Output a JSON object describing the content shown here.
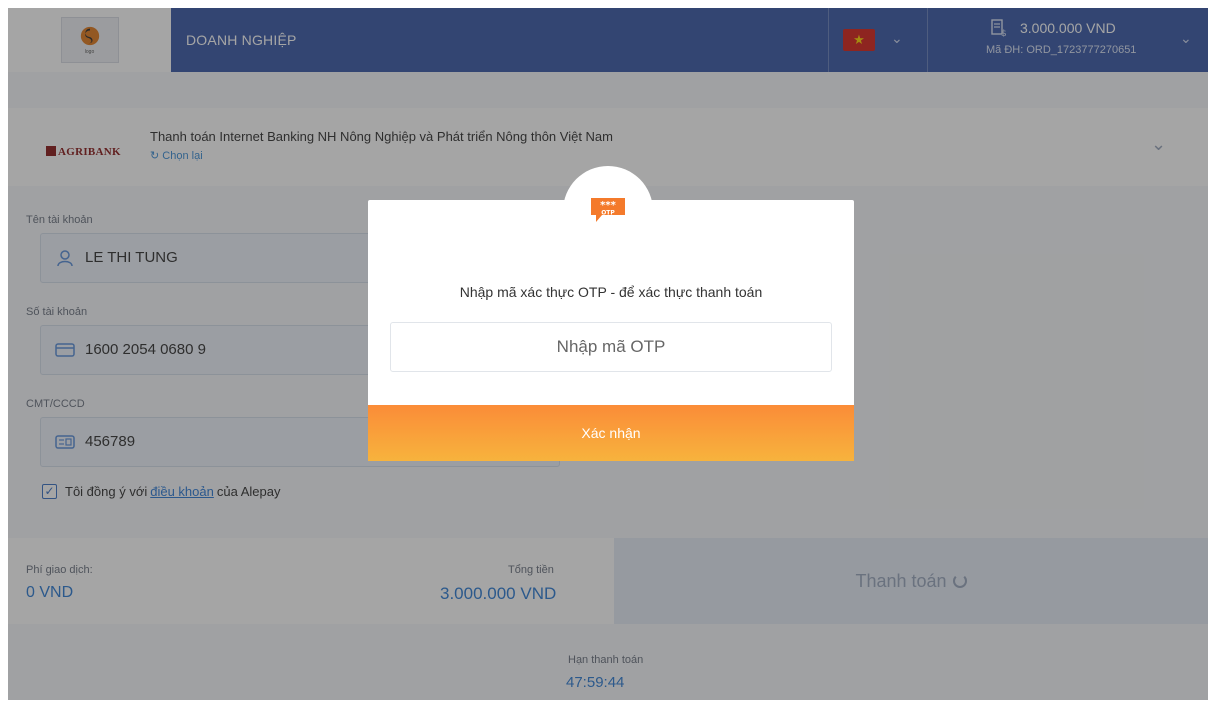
{
  "header": {
    "company_name": "DOANH NGHIỆP",
    "logo_text": "logo",
    "language_flag": "vietnam-flag",
    "amount": "3.000.000 VND",
    "order_id": "Mã ĐH: ORD_1723777270651"
  },
  "bank": {
    "logo_text": "AGRIBANK",
    "name": "Thanh toán Internet Banking NH Nông Nghiệp và Phát triển Nông thôn Việt Nam",
    "reselect": "Chọn lại"
  },
  "form": {
    "account_name_label": "Tên tài khoản",
    "account_name": "LE THI TUNG",
    "account_number_label": "Số tài khoản",
    "account_number": "1600 2054 0680 9",
    "id_label": "CMT/CCCD",
    "id_value": "456789",
    "agree_prefix": "Tôi đồng ý với",
    "agree_link": "điều khoản",
    "agree_suffix": "của Alepay",
    "agreed": true
  },
  "summary": {
    "fee_label": "Phí giao dịch:",
    "fee_value": "0 VND",
    "total_label": "Tổng tiền",
    "total_value": "3.000.000 VND",
    "pay_label": "Thanh toán",
    "deadline_label": "Hạn thanh toán",
    "deadline_value": "47:59:44"
  },
  "modal": {
    "title": "Nhập mã xác thực OTP - để xác thực thanh toán",
    "input_placeholder": "Nhập mã OTP",
    "input_value": "",
    "confirm_label": "Xác nhận",
    "otp_badge_stars": "***",
    "otp_badge_text": "OTP"
  },
  "colors": {
    "header_bg": "#3b5ba8",
    "accent_blue": "#2f7dd4",
    "confirm_gradient_top": "#fb8c38",
    "confirm_gradient_bottom": "#f7b33d",
    "overlay": "rgba(40,40,40,0.42)"
  }
}
